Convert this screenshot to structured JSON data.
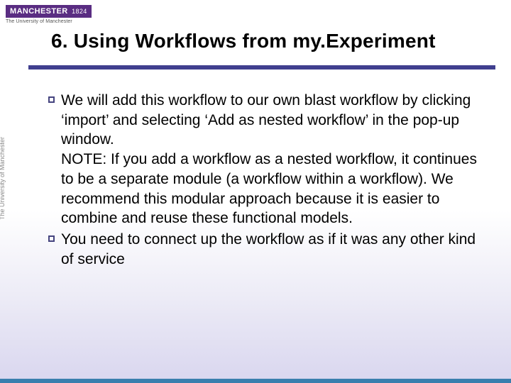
{
  "logo": {
    "name": "MANCHESTER",
    "year": "1824",
    "subtitle": "The University of Manchester"
  },
  "sidebar": {
    "vertical_text": "The University of Manchester"
  },
  "title": "6. Using Workflows from my.Experiment",
  "bullets": [
    "We will add this workflow to our own blast workflow by clicking ‘import’ and selecting ‘Add as nested workflow’ in the pop-up window.\nNOTE: If you add a workflow as a nested workflow, it continues to be a separate module (a workflow within a workflow). We recommend this modular approach because it is easier to combine and reuse these functional models.",
    "You need to connect up the workflow as if it was any other kind of service"
  ],
  "colors": {
    "accent_purple": "#5a2d82",
    "underline": "#403f8f",
    "footer": "#3a7fae"
  }
}
